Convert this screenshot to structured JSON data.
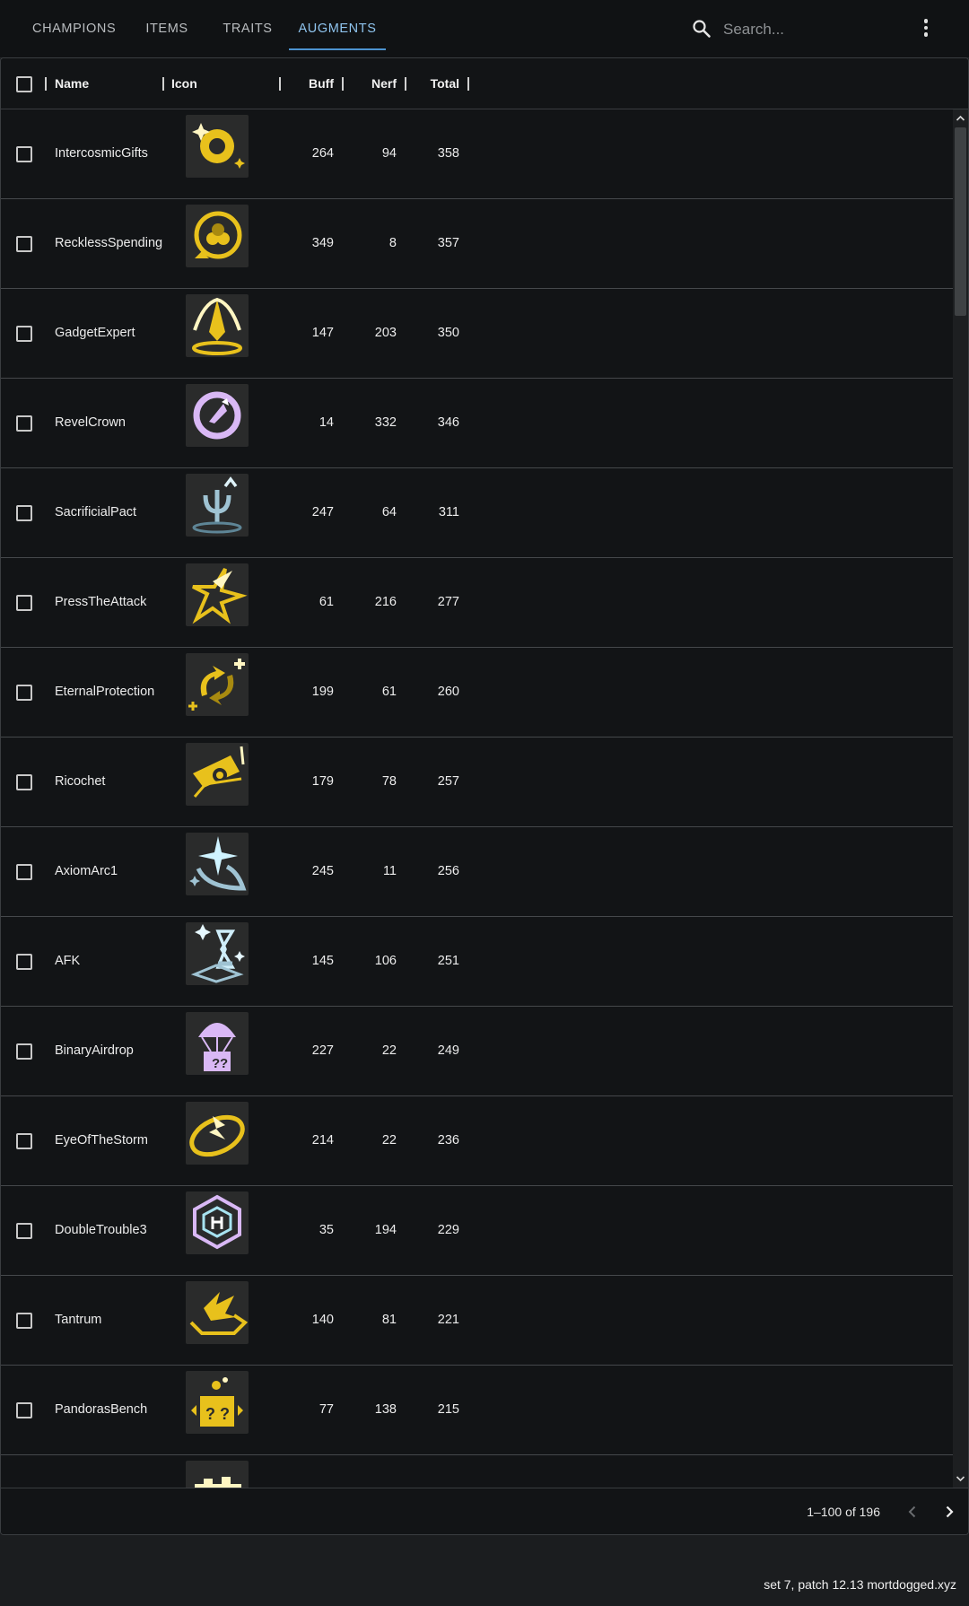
{
  "nav": {
    "tabs": [
      {
        "label": "CHAMPIONS",
        "active": false
      },
      {
        "label": "ITEMS",
        "active": false
      },
      {
        "label": "TRAITS",
        "active": false
      },
      {
        "label": "AUGMENTS",
        "active": true
      }
    ],
    "search": {
      "placeholder": "Search...",
      "value": "",
      "icon": "search-icon"
    },
    "menu_icon": "more-vert-icon"
  },
  "grid": {
    "columns": {
      "name": "Name",
      "icon": "Icon",
      "buff": "Buff",
      "nerf": "Nerf",
      "total": "Total"
    },
    "rows": [
      {
        "name": "IntercosmicGifts",
        "icon": "intercosmic-gifts-icon",
        "buff": "264",
        "nerf": "94",
        "total": "358"
      },
      {
        "name": "RecklessSpending",
        "icon": "reckless-spending-icon",
        "buff": "349",
        "nerf": "8",
        "total": "357"
      },
      {
        "name": "GadgetExpert",
        "icon": "gadget-expert-icon",
        "buff": "147",
        "nerf": "203",
        "total": "350"
      },
      {
        "name": "RevelCrown",
        "icon": "revel-crown-icon",
        "buff": "14",
        "nerf": "332",
        "total": "346"
      },
      {
        "name": "SacrificialPact",
        "icon": "sacrificial-pact-icon",
        "buff": "247",
        "nerf": "64",
        "total": "311"
      },
      {
        "name": "PressTheAttack",
        "icon": "press-the-attack-icon",
        "buff": "61",
        "nerf": "216",
        "total": "277"
      },
      {
        "name": "EternalProtection",
        "icon": "eternal-protection-icon",
        "buff": "199",
        "nerf": "61",
        "total": "260"
      },
      {
        "name": "Ricochet",
        "icon": "ricochet-icon",
        "buff": "179",
        "nerf": "78",
        "total": "257"
      },
      {
        "name": "AxiomArc1",
        "icon": "axiom-arc-icon",
        "buff": "245",
        "nerf": "11",
        "total": "256"
      },
      {
        "name": "AFK",
        "icon": "afk-icon",
        "buff": "145",
        "nerf": "106",
        "total": "251"
      },
      {
        "name": "BinaryAirdrop",
        "icon": "binary-airdrop-icon",
        "buff": "227",
        "nerf": "22",
        "total": "249"
      },
      {
        "name": "EyeOfTheStorm",
        "icon": "eye-of-the-storm-icon",
        "buff": "214",
        "nerf": "22",
        "total": "236"
      },
      {
        "name": "DoubleTrouble3",
        "icon": "double-trouble-icon",
        "buff": "35",
        "nerf": "194",
        "total": "229"
      },
      {
        "name": "Tantrum",
        "icon": "tantrum-icon",
        "buff": "140",
        "nerf": "81",
        "total": "221"
      },
      {
        "name": "PandorasBench",
        "icon": "pandoras-bench-icon",
        "buff": "77",
        "nerf": "138",
        "total": "215"
      },
      {
        "name": "",
        "icon": "partial-augment-icon",
        "buff": "",
        "nerf": "",
        "total": ""
      }
    ],
    "pagination": {
      "text": "1–100 of 196"
    }
  },
  "footer": {
    "credit": "set 7, patch 12.13 mortdogged.xyz"
  },
  "colors": {
    "gold": "#e8c11c",
    "accent": "#8fc4ee",
    "silver": "#8fb6c8",
    "prismatic": "#d6b3f5"
  }
}
